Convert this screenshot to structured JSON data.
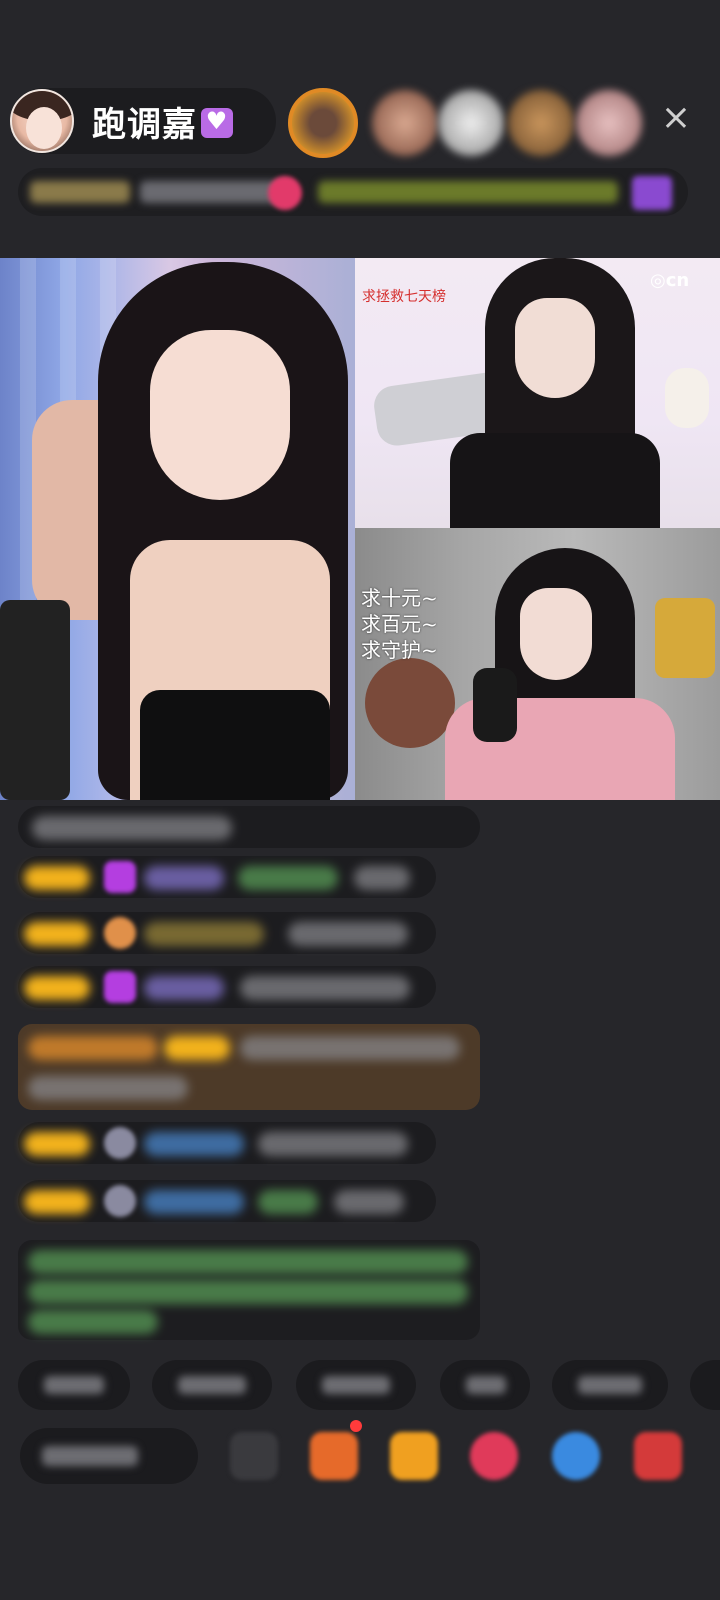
{
  "host": {
    "name": "跑调嘉",
    "badge_icon": "heart-badge-icon"
  },
  "header": {
    "close_label": "×"
  },
  "video": {
    "top_right_overlay": "求拯救七天榜",
    "bottom_right_overlay": "求十元~\n求百元~\n求守护~",
    "watermark": "◎cn"
  },
  "colors": {
    "background": "#26262a",
    "level_badge": "#f2b21c",
    "gift_banner": "#4d3a28",
    "system_text": "#5ca35a"
  }
}
